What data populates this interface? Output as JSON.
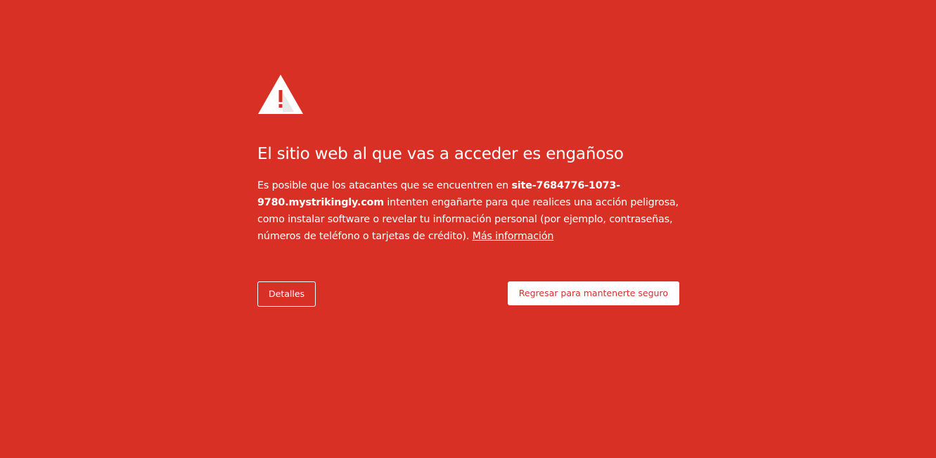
{
  "interstitial": {
    "icon": "warning-triangle-icon",
    "heading": "El sitio web al que vas a acceder es engañoso",
    "message": {
      "prefix": "Es posible que los atacantes que se encuentren en ",
      "site": "site-7684776-1073-9780.mystrikingly.com",
      "suffix": " intenten engañarte para que realices una acción peligrosa, como instalar software o revelar tu información personal (por ejemplo, contraseñas, números de teléfono o tarjetas de crédito). ",
      "learn_more": "Más información"
    },
    "details_button": "Detalles",
    "back_button": "Regresar para mantenerte seguro"
  },
  "colors": {
    "background": "#d93025",
    "foreground": "#ffffff"
  }
}
